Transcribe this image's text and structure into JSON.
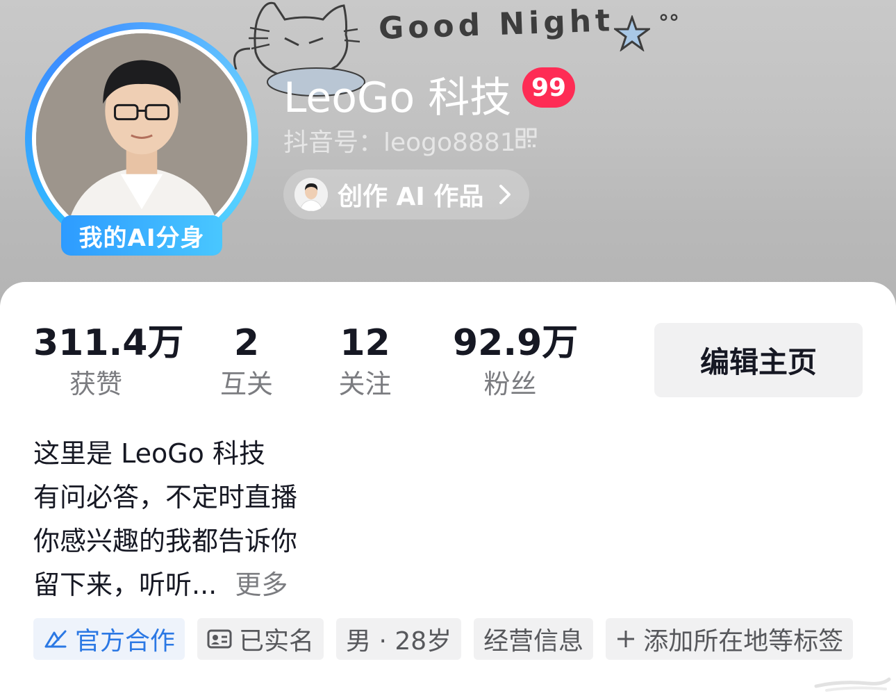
{
  "banner": {
    "text": "Good Night",
    "dots": "°°"
  },
  "profile": {
    "ai_badge": "我的AI分身",
    "username": "LeoGo 科技",
    "level": "99",
    "douyin_id": "抖音号：leogo8881",
    "ai_works_label": "创作 AI 作品"
  },
  "stats": [
    {
      "value": "311.4万",
      "label": "获赞"
    },
    {
      "value": "2",
      "label": "互关"
    },
    {
      "value": "12",
      "label": "关注"
    },
    {
      "value": "92.9万",
      "label": "粉丝"
    }
  ],
  "edit_button": "编辑主页",
  "bio": {
    "lines": [
      "这里是 LeoGo 科技",
      "有问必答，不定时直播",
      "你感兴趣的我都告诉你",
      "留下来，听听..."
    ],
    "more": "更多"
  },
  "tags": [
    {
      "label": "官方合作",
      "icon": "official-cooperation-icon"
    },
    {
      "label": "已实名",
      "icon": "id-card-icon"
    },
    {
      "label": "男 · 28岁"
    },
    {
      "label": "经营信息"
    },
    {
      "label": "添加所在地等标签",
      "icon": "plus-icon"
    }
  ],
  "colors": {
    "level_badge": "#fe2c55",
    "ai_badge": "#2d9bff",
    "official_tag": "#2b78e4",
    "primary_text": "#161823",
    "secondary_text": "#7b7c80"
  }
}
